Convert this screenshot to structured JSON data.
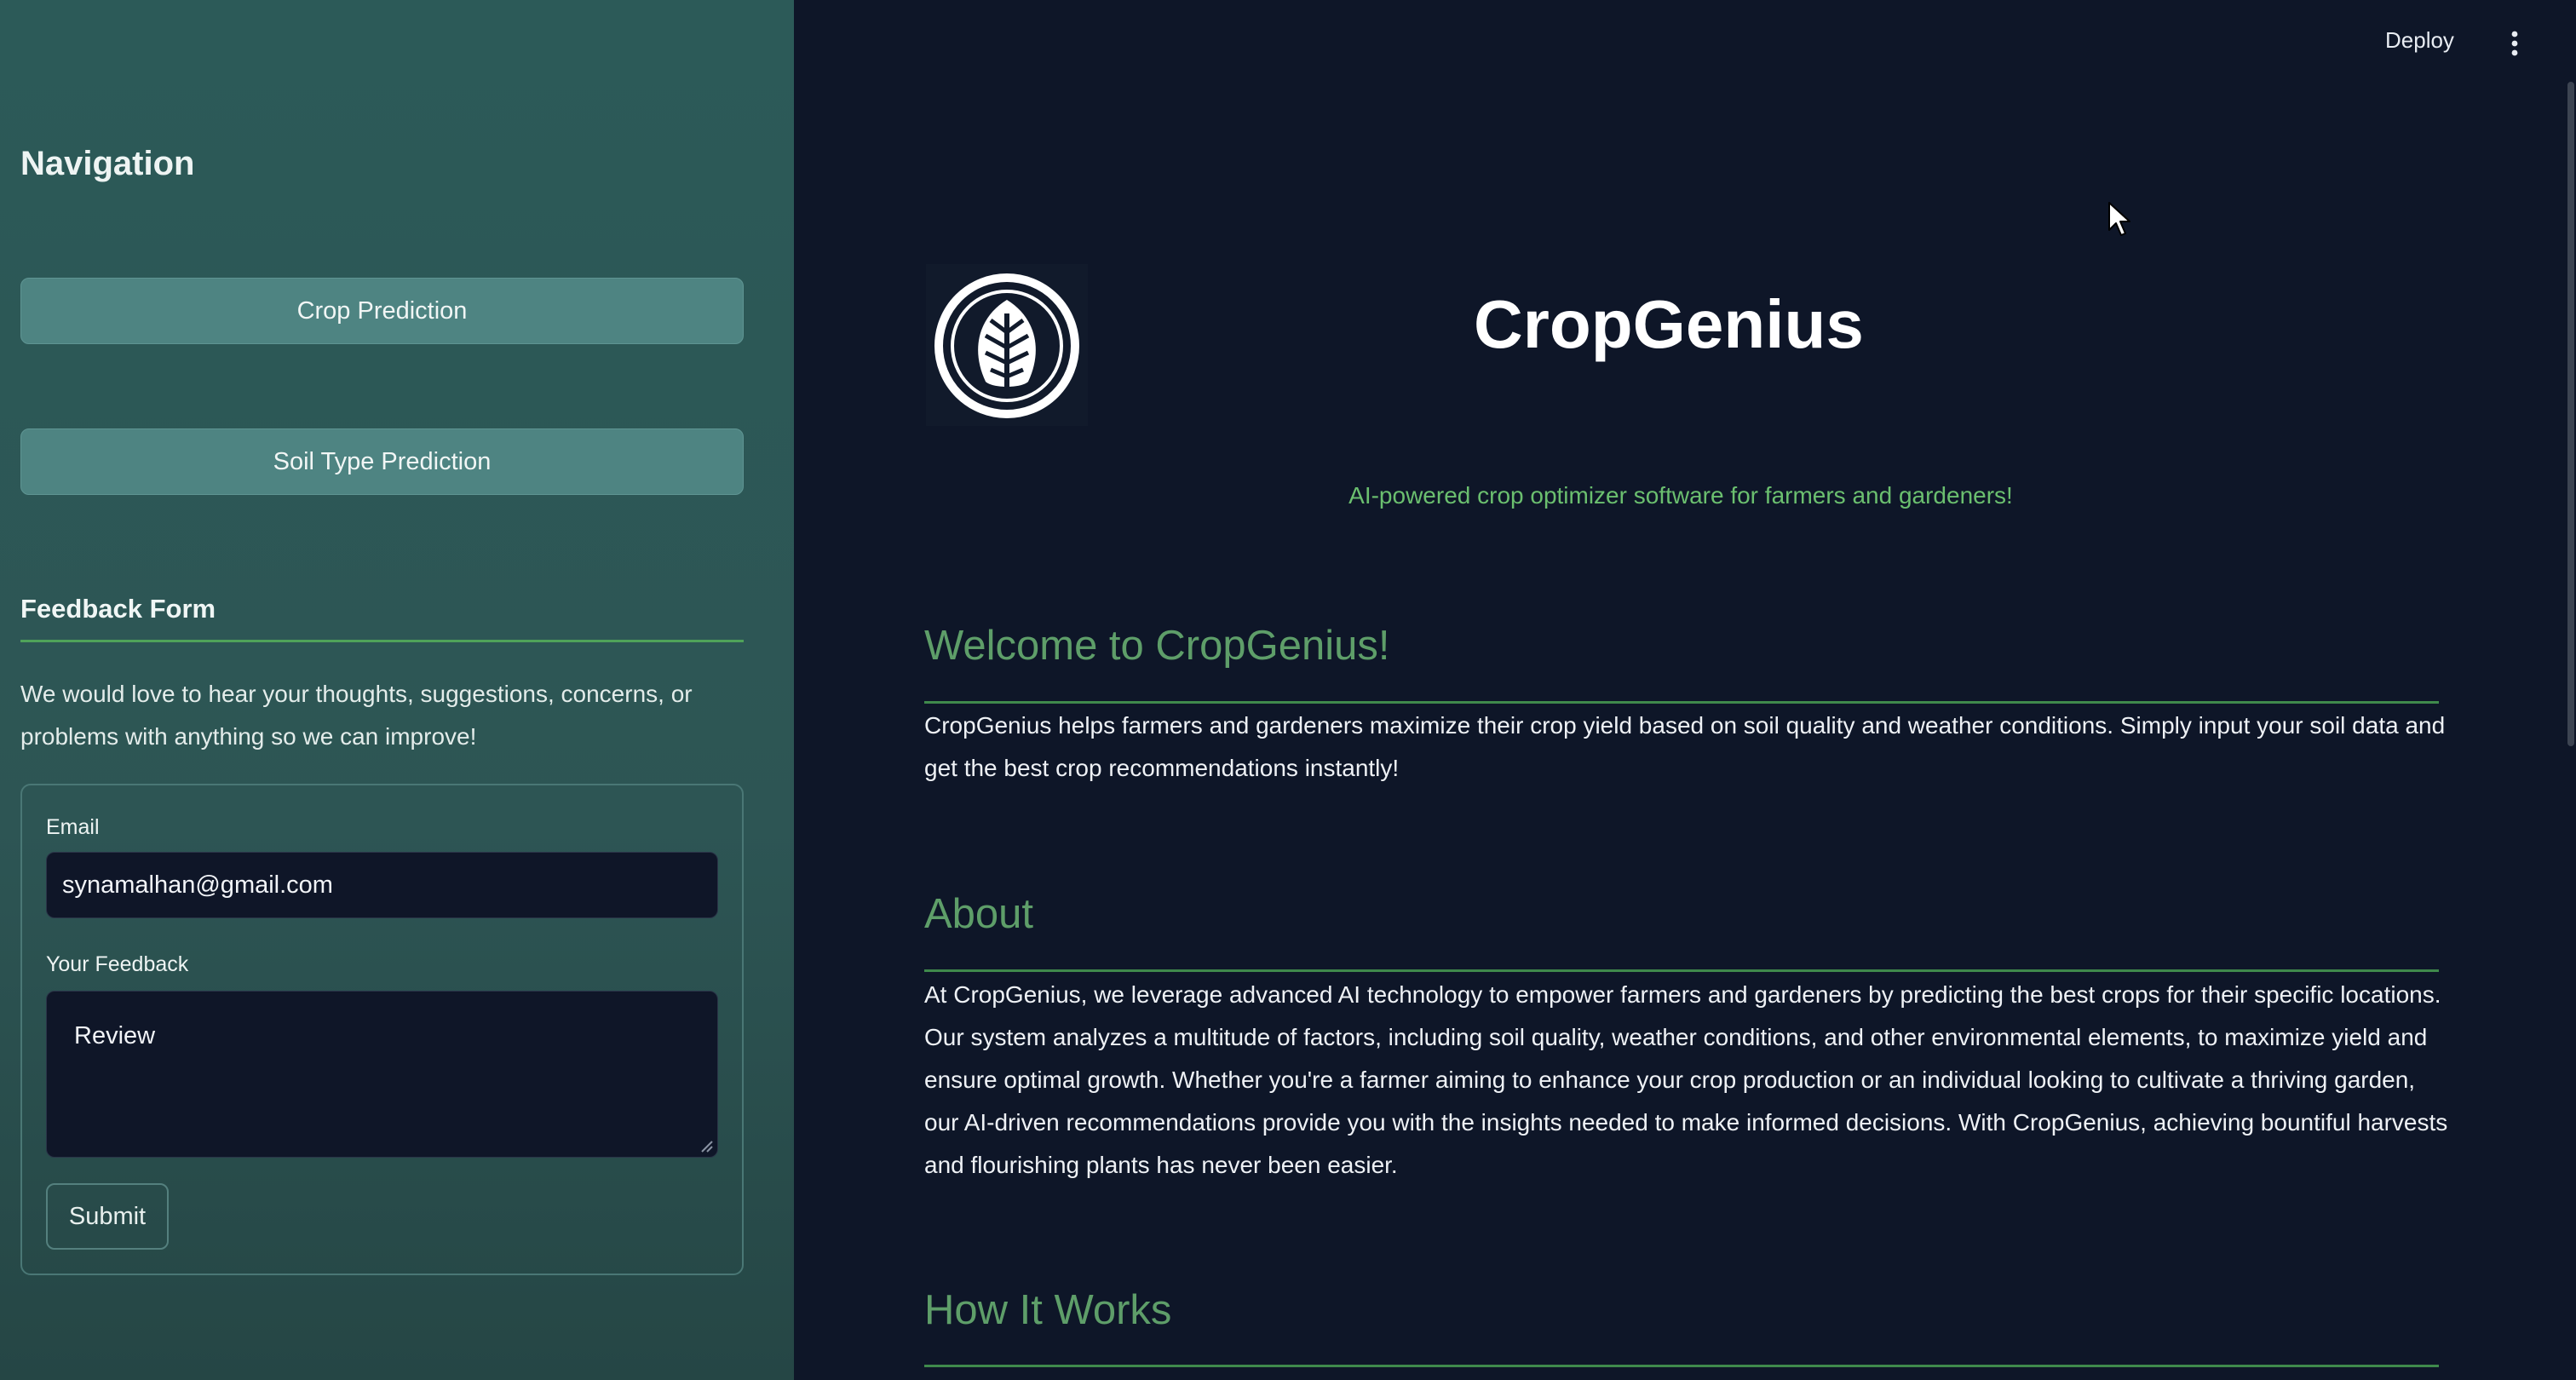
{
  "header": {
    "deploy_label": "Deploy",
    "menu_icon": "kebab-menu-icon"
  },
  "sidebar": {
    "title": "Navigation",
    "nav_buttons": [
      {
        "label": "Crop Prediction"
      },
      {
        "label": "Soil Type Prediction"
      }
    ],
    "feedback": {
      "title": "Feedback Form",
      "description": "We would love to hear your thoughts, suggestions, concerns, or problems with anything so we can improve!",
      "email_label": "Email",
      "email_value": "synamalhan@gmail.com",
      "feedback_label": "Your Feedback",
      "feedback_value": "Review",
      "submit_label": "Submit"
    }
  },
  "main": {
    "logo_icon": "leaf-logo-icon",
    "title": "CropGenius",
    "tagline": "AI-powered crop optimizer software for farmers and gardeners!",
    "sections": [
      {
        "heading": "Welcome to CropGenius!",
        "body": "CropGenius helps farmers and gardeners maximize their crop yield based on soil quality and weather conditions. Simply input your soil data and get the best crop recommendations instantly!"
      },
      {
        "heading": "About",
        "body": "At CropGenius, we leverage advanced AI technology to empower farmers and gardeners by predicting the best crops for their specific locations. Our system analyzes a multitude of factors, including soil quality, weather conditions, and other environmental elements, to maximize yield and ensure optimal growth. Whether you're a farmer aiming to enhance your crop production or an individual looking to cultivate a thriving garden, our AI-driven recommendations provide you with the insights needed to make informed decisions. With CropGenius, achieving bountiful harvests and flourishing plants has never been easier."
      },
      {
        "heading": "How It Works"
      }
    ]
  },
  "colors": {
    "sidebar_bg": "#2c5a58",
    "main_bg": "#0e1628",
    "nav_button": "#4e8482",
    "accent_green": "#5e9e69",
    "tagline_green": "#6bbf6f"
  }
}
